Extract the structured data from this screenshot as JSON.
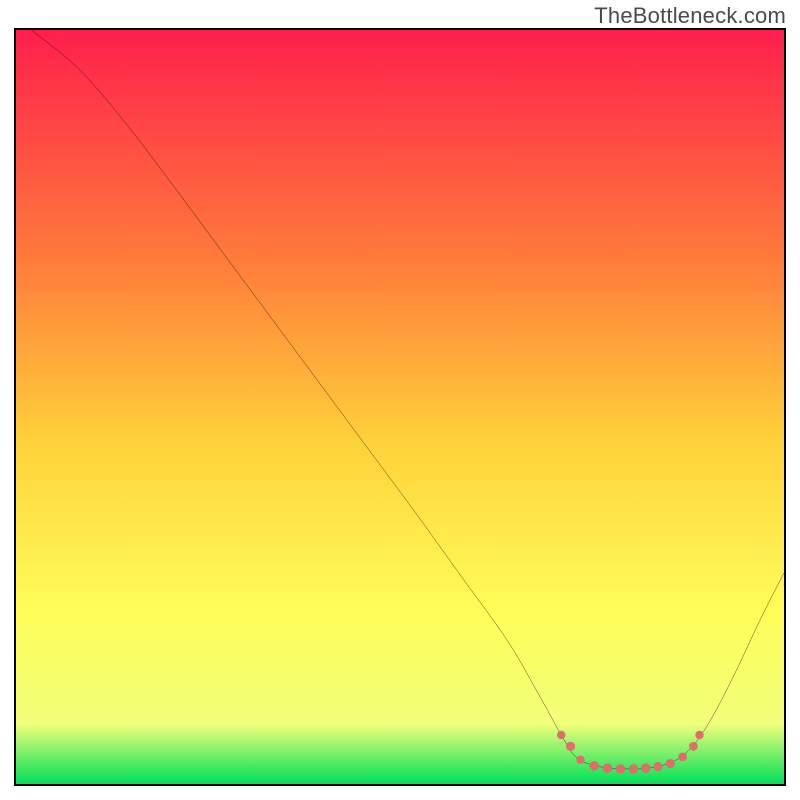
{
  "watermark": "TheBottleneck.com",
  "chart_data": {
    "type": "line",
    "title": "",
    "xlabel": "",
    "ylabel": "",
    "xlim": [
      0,
      100
    ],
    "ylim": [
      0,
      100
    ],
    "gradient_colors": {
      "top": "#ff1f4d",
      "mid_upper": "#ff7a3b",
      "mid": "#ffd23a",
      "mid_lower": "#ffff5a",
      "low": "#f2ff7a",
      "bottom": "#00e05a"
    },
    "marker_color": "#e06c6c",
    "curve_estimated": "Curve is drawn qualitatively: descends from top-left, reaches minimum basin roughly between x≈70 and x≈87 near y≈2–3, then rises toward the right edge reaching y≈28 at x=100. Y rendered with 0 at bottom.",
    "series": [
      {
        "name": "curve",
        "points": [
          {
            "x": 2.0,
            "y": 100.0
          },
          {
            "x": 8.0,
            "y": 95.0
          },
          {
            "x": 14.0,
            "y": 88.0
          },
          {
            "x": 20.0,
            "y": 80.0
          },
          {
            "x": 28.0,
            "y": 69.0
          },
          {
            "x": 36.0,
            "y": 58.0
          },
          {
            "x": 44.0,
            "y": 47.0
          },
          {
            "x": 52.0,
            "y": 36.0
          },
          {
            "x": 58.0,
            "y": 27.5
          },
          {
            "x": 64.0,
            "y": 19.0
          },
          {
            "x": 68.0,
            "y": 12.0
          },
          {
            "x": 71.0,
            "y": 6.5
          },
          {
            "x": 73.0,
            "y": 3.5
          },
          {
            "x": 76.0,
            "y": 2.3
          },
          {
            "x": 80.0,
            "y": 2.0
          },
          {
            "x": 83.0,
            "y": 2.2
          },
          {
            "x": 86.0,
            "y": 3.2
          },
          {
            "x": 88.5,
            "y": 5.5
          },
          {
            "x": 91.0,
            "y": 9.5
          },
          {
            "x": 94.0,
            "y": 15.5
          },
          {
            "x": 97.0,
            "y": 22.0
          },
          {
            "x": 100.0,
            "y": 28.0
          }
        ]
      }
    ],
    "markers": [
      {
        "x": 71.0,
        "y": 6.5,
        "r": 4.2
      },
      {
        "x": 72.2,
        "y": 5.0,
        "r": 4.6
      },
      {
        "x": 73.5,
        "y": 3.2,
        "r": 4.2
      },
      {
        "x": 75.3,
        "y": 2.4,
        "r": 4.8
      },
      {
        "x": 77.0,
        "y": 2.1,
        "r": 4.8
      },
      {
        "x": 78.7,
        "y": 2.0,
        "r": 4.8
      },
      {
        "x": 80.4,
        "y": 2.0,
        "r": 4.8
      },
      {
        "x": 82.0,
        "y": 2.1,
        "r": 4.8
      },
      {
        "x": 83.6,
        "y": 2.3,
        "r": 4.6
      },
      {
        "x": 85.2,
        "y": 2.7,
        "r": 4.6
      },
      {
        "x": 86.8,
        "y": 3.6,
        "r": 4.4
      },
      {
        "x": 88.2,
        "y": 5.0,
        "r": 4.4
      },
      {
        "x": 89.0,
        "y": 6.5,
        "r": 4.2
      }
    ]
  }
}
